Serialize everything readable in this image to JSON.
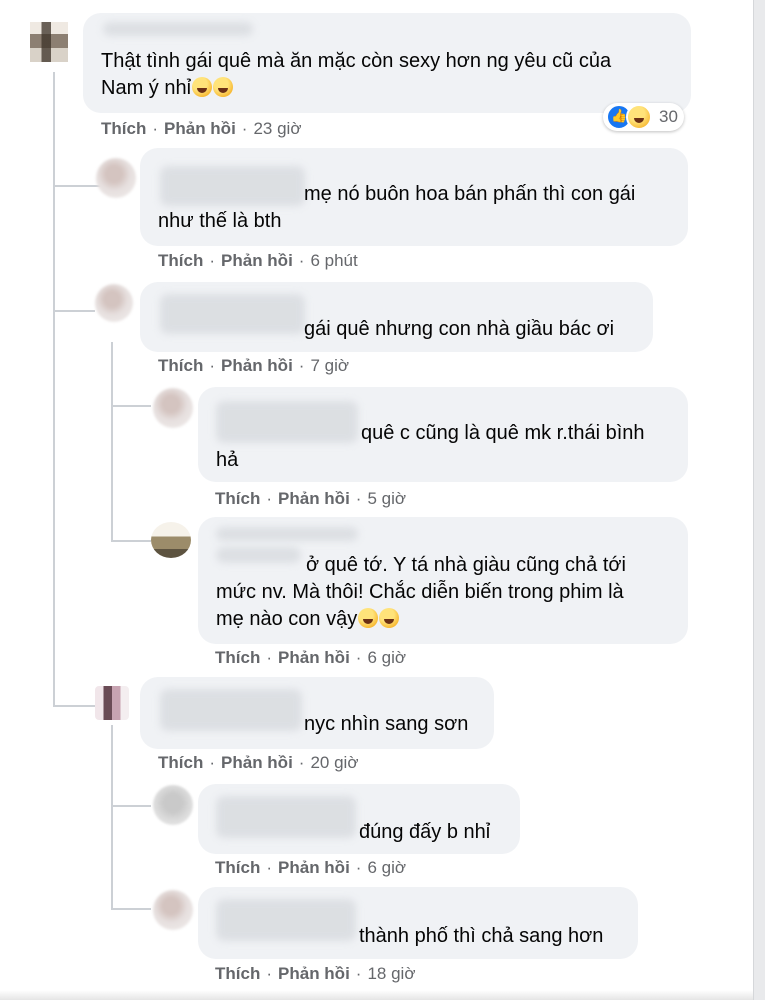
{
  "comments": [
    {
      "text": "Thật tình gái quê mà ăn mặc còn sexy hơn ng yêu cũ của\nNam ý nhỉ",
      "emoji": [
        "rolling-on-floor-laughing",
        "rolling-on-floor-laughing"
      ],
      "like": "Thích",
      "reply": "Phản hồi",
      "time": "23 giờ",
      "reaction_count": "30",
      "reaction_icons": [
        "like",
        "haha"
      ]
    },
    {
      "text": "mẹ nó buôn hoa bán phấn thì con gái\nnhư thế là bth",
      "like": "Thích",
      "reply": "Phản hồi",
      "time": "6 phút"
    },
    {
      "text": "gái quê nhưng con nhà giầu bác ơi",
      "like": "Thích",
      "reply": "Phản hồi",
      "time": "7 giờ"
    },
    {
      "text": "quê c cũng là quê mk r.thái bình\nhả",
      "like": "Thích",
      "reply": "Phản hồi",
      "time": "5 giờ"
    },
    {
      "text": "ở quê tớ. Y tá nhà giàu cũng chả tới\nmức nv. Mà thôi! Chắc diễn biến trong phim là\nmẹ nào con vậy",
      "emoji": [
        "grinning-sweat",
        "grinning-sweat"
      ],
      "like": "Thích",
      "reply": "Phản hồi",
      "time": "6 giờ"
    },
    {
      "text": "nyc nhìn sang sơn",
      "like": "Thích",
      "reply": "Phản hồi",
      "time": "20 giờ"
    },
    {
      "text": "đúng đấy b nhỉ",
      "like": "Thích",
      "reply": "Phản hồi",
      "time": "6 giờ"
    },
    {
      "text": "thành phố thì chả sang hơn",
      "like": "Thích",
      "reply": "Phản hồi",
      "time": "18 giờ"
    }
  ],
  "separator": "·"
}
